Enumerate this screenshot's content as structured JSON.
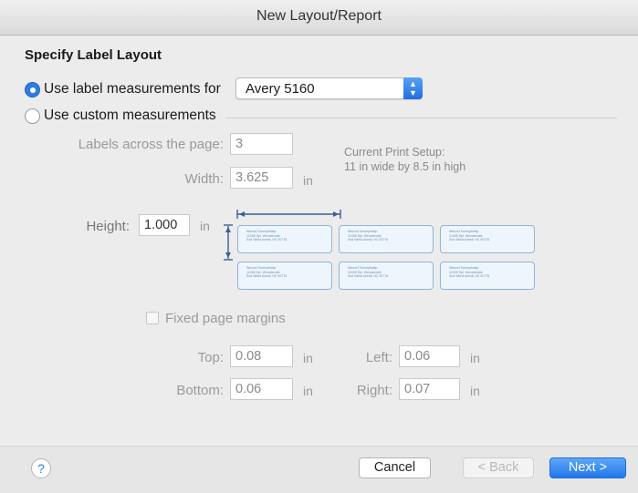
{
  "window": {
    "title": "New Layout/Report"
  },
  "section": {
    "heading": "Specify Label Layout"
  },
  "options": {
    "use_label_measurements_label": "Use label measurements for",
    "use_label_measurements_selected": true,
    "label_product": "Avery 5160",
    "use_custom_measurements_label": "Use custom measurements",
    "use_custom_measurements_selected": false
  },
  "layout": {
    "labels_across_label": "Labels across the page:",
    "labels_across_value": "3",
    "width_label": "Width:",
    "width_value": "3.625",
    "width_unit": "in",
    "height_label": "Height:",
    "height_value": "1.000",
    "height_unit": "in"
  },
  "print_setup": {
    "title": "Current Print Setup:",
    "detail": "11 in wide by 8.5 in high"
  },
  "margins": {
    "fixed_label": "Fixed page margins",
    "fixed_checked": false,
    "top_label": "Top:",
    "top_value": "0.08",
    "bottom_label": "Bottom:",
    "bottom_value": "0.06",
    "left_label": "Left:",
    "left_value": "0.06",
    "right_label": "Right:",
    "right_value": "0.07",
    "unit": "in"
  },
  "footer": {
    "help": "?",
    "cancel": "Cancel",
    "back": "< Back",
    "next": "Next >"
  },
  "colors": {
    "accent": "#2f7de1",
    "label_border": "#8fb4dc",
    "disabled_text": "#9a9a9a"
  }
}
